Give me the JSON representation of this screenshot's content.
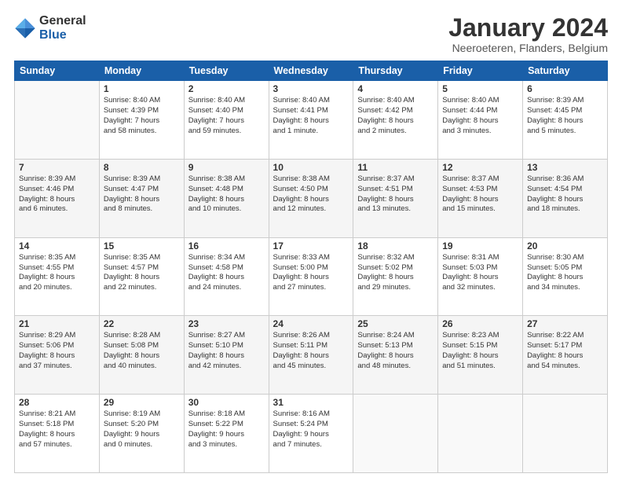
{
  "header": {
    "logo_general": "General",
    "logo_blue": "Blue",
    "month_title": "January 2024",
    "location": "Neeroeteren, Flanders, Belgium"
  },
  "days_of_week": [
    "Sunday",
    "Monday",
    "Tuesday",
    "Wednesday",
    "Thursday",
    "Friday",
    "Saturday"
  ],
  "weeks": [
    [
      {
        "day": "",
        "info": ""
      },
      {
        "day": "1",
        "info": "Sunrise: 8:40 AM\nSunset: 4:39 PM\nDaylight: 7 hours\nand 58 minutes."
      },
      {
        "day": "2",
        "info": "Sunrise: 8:40 AM\nSunset: 4:40 PM\nDaylight: 7 hours\nand 59 minutes."
      },
      {
        "day": "3",
        "info": "Sunrise: 8:40 AM\nSunset: 4:41 PM\nDaylight: 8 hours\nand 1 minute."
      },
      {
        "day": "4",
        "info": "Sunrise: 8:40 AM\nSunset: 4:42 PM\nDaylight: 8 hours\nand 2 minutes."
      },
      {
        "day": "5",
        "info": "Sunrise: 8:40 AM\nSunset: 4:44 PM\nDaylight: 8 hours\nand 3 minutes."
      },
      {
        "day": "6",
        "info": "Sunrise: 8:39 AM\nSunset: 4:45 PM\nDaylight: 8 hours\nand 5 minutes."
      }
    ],
    [
      {
        "day": "7",
        "info": "Sunrise: 8:39 AM\nSunset: 4:46 PM\nDaylight: 8 hours\nand 6 minutes."
      },
      {
        "day": "8",
        "info": "Sunrise: 8:39 AM\nSunset: 4:47 PM\nDaylight: 8 hours\nand 8 minutes."
      },
      {
        "day": "9",
        "info": "Sunrise: 8:38 AM\nSunset: 4:48 PM\nDaylight: 8 hours\nand 10 minutes."
      },
      {
        "day": "10",
        "info": "Sunrise: 8:38 AM\nSunset: 4:50 PM\nDaylight: 8 hours\nand 12 minutes."
      },
      {
        "day": "11",
        "info": "Sunrise: 8:37 AM\nSunset: 4:51 PM\nDaylight: 8 hours\nand 13 minutes."
      },
      {
        "day": "12",
        "info": "Sunrise: 8:37 AM\nSunset: 4:53 PM\nDaylight: 8 hours\nand 15 minutes."
      },
      {
        "day": "13",
        "info": "Sunrise: 8:36 AM\nSunset: 4:54 PM\nDaylight: 8 hours\nand 18 minutes."
      }
    ],
    [
      {
        "day": "14",
        "info": "Sunrise: 8:35 AM\nSunset: 4:55 PM\nDaylight: 8 hours\nand 20 minutes."
      },
      {
        "day": "15",
        "info": "Sunrise: 8:35 AM\nSunset: 4:57 PM\nDaylight: 8 hours\nand 22 minutes."
      },
      {
        "day": "16",
        "info": "Sunrise: 8:34 AM\nSunset: 4:58 PM\nDaylight: 8 hours\nand 24 minutes."
      },
      {
        "day": "17",
        "info": "Sunrise: 8:33 AM\nSunset: 5:00 PM\nDaylight: 8 hours\nand 27 minutes."
      },
      {
        "day": "18",
        "info": "Sunrise: 8:32 AM\nSunset: 5:02 PM\nDaylight: 8 hours\nand 29 minutes."
      },
      {
        "day": "19",
        "info": "Sunrise: 8:31 AM\nSunset: 5:03 PM\nDaylight: 8 hours\nand 32 minutes."
      },
      {
        "day": "20",
        "info": "Sunrise: 8:30 AM\nSunset: 5:05 PM\nDaylight: 8 hours\nand 34 minutes."
      }
    ],
    [
      {
        "day": "21",
        "info": "Sunrise: 8:29 AM\nSunset: 5:06 PM\nDaylight: 8 hours\nand 37 minutes."
      },
      {
        "day": "22",
        "info": "Sunrise: 8:28 AM\nSunset: 5:08 PM\nDaylight: 8 hours\nand 40 minutes."
      },
      {
        "day": "23",
        "info": "Sunrise: 8:27 AM\nSunset: 5:10 PM\nDaylight: 8 hours\nand 42 minutes."
      },
      {
        "day": "24",
        "info": "Sunrise: 8:26 AM\nSunset: 5:11 PM\nDaylight: 8 hours\nand 45 minutes."
      },
      {
        "day": "25",
        "info": "Sunrise: 8:24 AM\nSunset: 5:13 PM\nDaylight: 8 hours\nand 48 minutes."
      },
      {
        "day": "26",
        "info": "Sunrise: 8:23 AM\nSunset: 5:15 PM\nDaylight: 8 hours\nand 51 minutes."
      },
      {
        "day": "27",
        "info": "Sunrise: 8:22 AM\nSunset: 5:17 PM\nDaylight: 8 hours\nand 54 minutes."
      }
    ],
    [
      {
        "day": "28",
        "info": "Sunrise: 8:21 AM\nSunset: 5:18 PM\nDaylight: 8 hours\nand 57 minutes."
      },
      {
        "day": "29",
        "info": "Sunrise: 8:19 AM\nSunset: 5:20 PM\nDaylight: 9 hours\nand 0 minutes."
      },
      {
        "day": "30",
        "info": "Sunrise: 8:18 AM\nSunset: 5:22 PM\nDaylight: 9 hours\nand 3 minutes."
      },
      {
        "day": "31",
        "info": "Sunrise: 8:16 AM\nSunset: 5:24 PM\nDaylight: 9 hours\nand 7 minutes."
      },
      {
        "day": "",
        "info": ""
      },
      {
        "day": "",
        "info": ""
      },
      {
        "day": "",
        "info": ""
      }
    ]
  ]
}
